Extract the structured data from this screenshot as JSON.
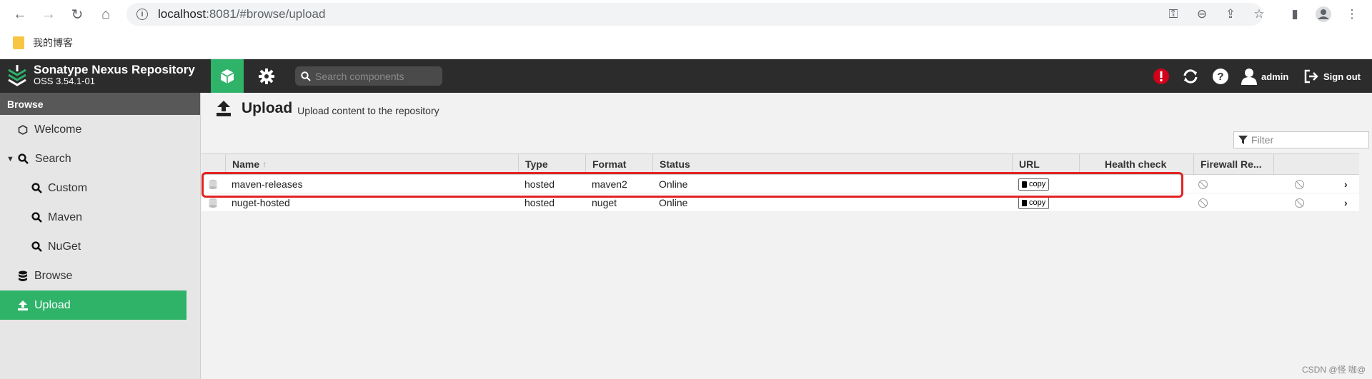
{
  "browser": {
    "url_host": "localhost",
    "url_path": ":8081/#browse/upload",
    "bookmark": "我的博客"
  },
  "header": {
    "product_name": "Sonatype Nexus Repository",
    "version": "OSS 3.54.1-01",
    "search_placeholder": "Search components",
    "user": "admin",
    "sign_out": "Sign out"
  },
  "sidebar": {
    "heading": "Browse",
    "items": [
      {
        "label": "Welcome",
        "icon": "hexagon-icon"
      },
      {
        "label": "Search",
        "icon": "search-icon"
      },
      {
        "label": "Custom",
        "icon": "search-icon"
      },
      {
        "label": "Maven",
        "icon": "search-icon"
      },
      {
        "label": "NuGet",
        "icon": "search-icon"
      },
      {
        "label": "Browse",
        "icon": "database-icon"
      },
      {
        "label": "Upload",
        "icon": "upload-icon"
      }
    ]
  },
  "page": {
    "title": "Upload",
    "subtitle": "Upload content to the repository",
    "filter_placeholder": "Filter"
  },
  "table": {
    "columns": [
      "Name",
      "Type",
      "Format",
      "Status",
      "URL",
      "Health check",
      "Firewall Re..."
    ],
    "rows": [
      {
        "name": "maven-releases",
        "type": "hosted",
        "format": "maven2",
        "status": "Online",
        "url_button": "copy"
      },
      {
        "name": "nuget-hosted",
        "type": "hosted",
        "format": "nuget",
        "status": "Online",
        "url_button": "copy"
      }
    ]
  },
  "watermark": "CSDN @怪 咖@",
  "colors": {
    "accent": "#2eb369",
    "header_bg": "#2c2c2c",
    "highlight": "#e32222"
  }
}
